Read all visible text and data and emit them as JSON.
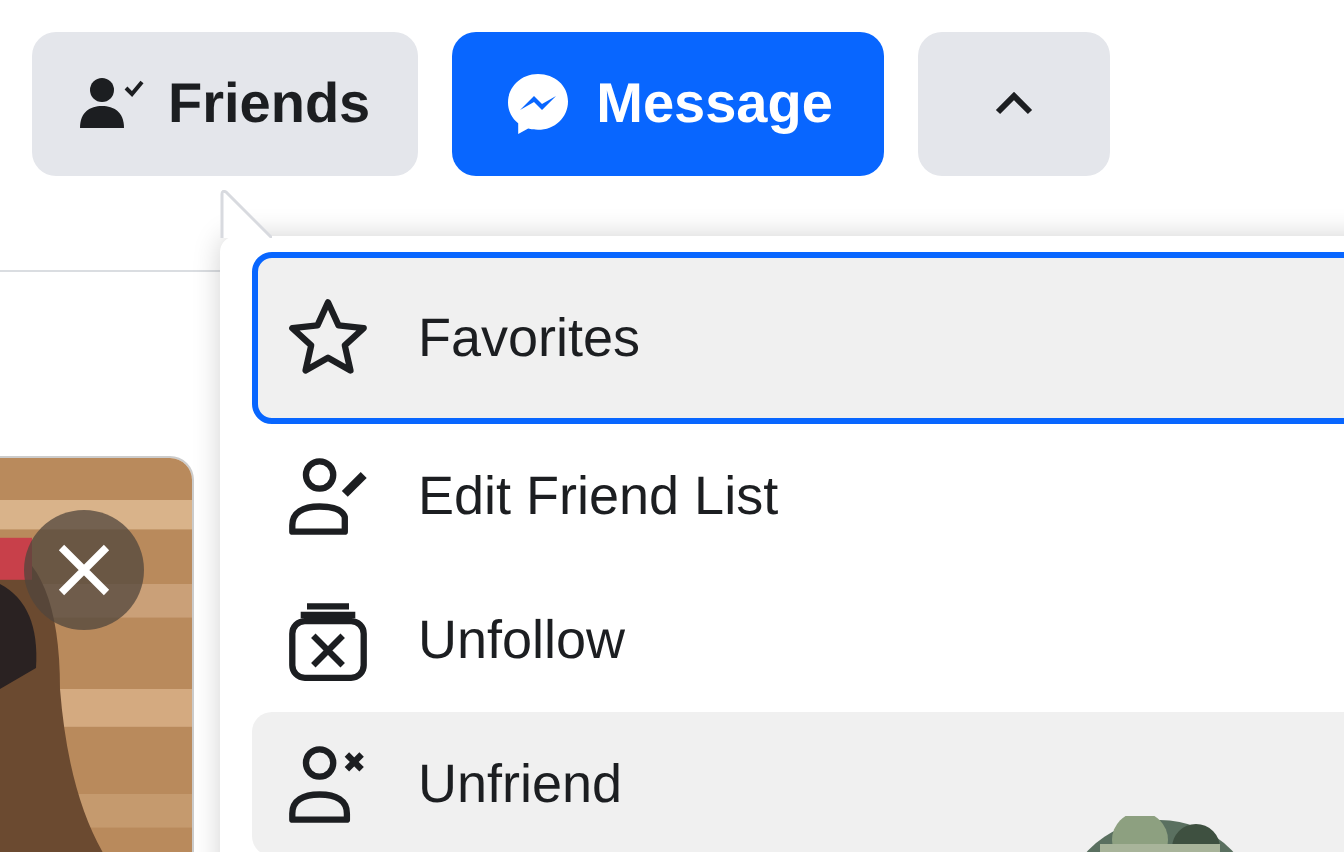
{
  "profile_actions": [
    {
      "kind": "friends",
      "label": "Friends"
    },
    {
      "kind": "message",
      "label": "Message"
    },
    {
      "kind": "more"
    }
  ],
  "menu": {
    "expanded": true,
    "items": [
      {
        "label": "Favorites",
        "focused": true,
        "highlighted": false
      },
      {
        "label": "Edit Friend List",
        "focused": false,
        "highlighted": false
      },
      {
        "label": "Unfollow",
        "focused": false,
        "highlighted": false
      },
      {
        "label": "Unfriend",
        "focused": false,
        "highlighted": true
      }
    ]
  }
}
